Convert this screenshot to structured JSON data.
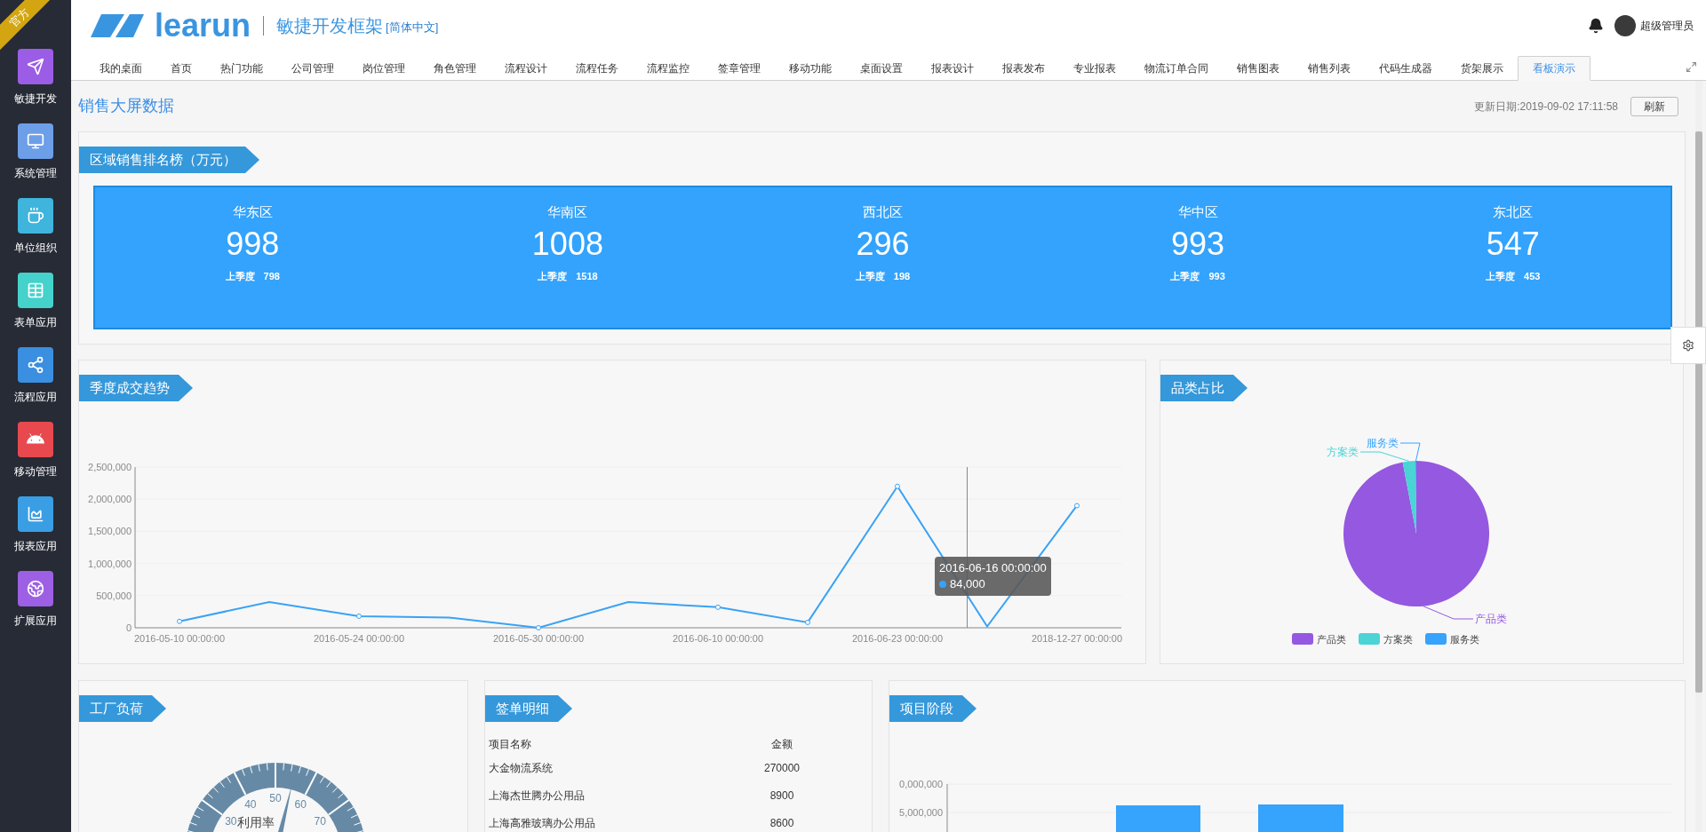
{
  "sidebar": {
    "badge": "官方",
    "items": [
      {
        "label": "敏捷开发",
        "color": "#9b5de5"
      },
      {
        "label": "系统管理",
        "color": "#6d9ee8"
      },
      {
        "label": "单位组织",
        "color": "#3fb4dc"
      },
      {
        "label": "表单应用",
        "color": "#45d2cb"
      },
      {
        "label": "流程应用",
        "color": "#3a8fe0"
      },
      {
        "label": "移动管理",
        "color": "#e8494f"
      },
      {
        "label": "报表应用",
        "color": "#3a9ee4"
      },
      {
        "label": "扩展应用",
        "color": "#9d5fe3"
      }
    ]
  },
  "header": {
    "logo": "learun",
    "product": "敏捷开发框架",
    "language": "[简体中文]",
    "user": "超级管理员"
  },
  "tabs": [
    {
      "label": "我的桌面",
      "selected": false
    },
    {
      "label": "首页",
      "selected": false
    },
    {
      "label": "热门功能",
      "selected": false
    },
    {
      "label": "公司管理",
      "selected": false
    },
    {
      "label": "岗位管理",
      "selected": false
    },
    {
      "label": "角色管理",
      "selected": false
    },
    {
      "label": "流程设计",
      "selected": false
    },
    {
      "label": "流程任务",
      "selected": false
    },
    {
      "label": "流程监控",
      "selected": false
    },
    {
      "label": "签章管理",
      "selected": false
    },
    {
      "label": "移动功能",
      "selected": false
    },
    {
      "label": "桌面设置",
      "selected": false
    },
    {
      "label": "报表设计",
      "selected": false
    },
    {
      "label": "报表发布",
      "selected": false
    },
    {
      "label": "专业报表",
      "selected": false
    },
    {
      "label": "物流订单合同",
      "selected": false
    },
    {
      "label": "销售图表",
      "selected": false
    },
    {
      "label": "销售列表",
      "selected": false
    },
    {
      "label": "代码生成器",
      "selected": false
    },
    {
      "label": "货架展示",
      "selected": false
    },
    {
      "label": "看板演示",
      "selected": true
    }
  ],
  "page": {
    "title": "销售大屏数据",
    "updated": "更新日期:2019-09-02 17:11:58",
    "refresh": "刷新"
  },
  "ranking": {
    "title": "区域销售排名榜（万元）",
    "regions": [
      {
        "name": "华东区",
        "value": "998",
        "prev_label": "上季度",
        "prev_value": "798"
      },
      {
        "name": "华南区",
        "value": "1008",
        "prev_label": "上季度",
        "prev_value": "1518"
      },
      {
        "name": "西北区",
        "value": "296",
        "prev_label": "上季度",
        "prev_value": "198"
      },
      {
        "name": "华中区",
        "value": "993",
        "prev_label": "上季度",
        "prev_value": "993"
      },
      {
        "name": "东北区",
        "value": "547",
        "prev_label": "上季度",
        "prev_value": "453"
      }
    ]
  },
  "trend": {
    "title": "季度成交趋势",
    "chart_data": {
      "type": "line",
      "categories": [
        "2016-05-10 00:00:00",
        null,
        "2016-05-24 00:00:00",
        null,
        "2016-05-30 00:00:00",
        null,
        "2016-06-10 00:00:00",
        null,
        "2016-06-23 00:00:00",
        null,
        "2018-12-27 00:00:00"
      ],
      "values": [
        100000,
        400000,
        180000,
        160000,
        0,
        400000,
        320000,
        84000,
        2200000,
        20000,
        1900000
      ],
      "yticks": [
        {
          "value": 0,
          "label": "0"
        },
        {
          "value": 500000,
          "label": "500,000"
        },
        {
          "value": 1000000,
          "label": "1,000,000"
        },
        {
          "value": 1500000,
          "label": "1,500,000"
        },
        {
          "value": 2000000,
          "label": "2,000,000"
        },
        {
          "value": 2500000,
          "label": "2,500,000"
        }
      ],
      "ylim": [
        0,
        2500000
      ]
    },
    "tooltip": {
      "date": "2016-06-16 00:00:00",
      "value": "84,000"
    }
  },
  "category": {
    "title": "品类占比",
    "chart_data": {
      "type": "pie",
      "categories": [
        "产品类",
        "方案类",
        "服务类"
      ],
      "values": [
        97,
        2.8,
        0.2
      ],
      "colors": [
        "#9558e0",
        "#4ad4d6",
        "#36a3fc"
      ]
    },
    "legend": [
      "产品类",
      "方案类",
      "服务类"
    ]
  },
  "factory": {
    "title": "工厂负荷",
    "gauge": {
      "name": "利用率",
      "scale_labels": [
        "30",
        "40",
        "50",
        "60",
        "70"
      ]
    }
  },
  "orders": {
    "title": "签单明细",
    "columns": [
      "项目名称",
      "金额"
    ],
    "rows": [
      [
        "大金物流系统",
        "270000"
      ],
      [
        "上海杰世腾办公用品",
        "8900"
      ],
      [
        "上海高雅玻璃办公用品",
        "8600"
      ]
    ]
  },
  "stages": {
    "title": "项目阶段",
    "axis_labels": [
      "0,000,000",
      "5,000,000"
    ]
  }
}
